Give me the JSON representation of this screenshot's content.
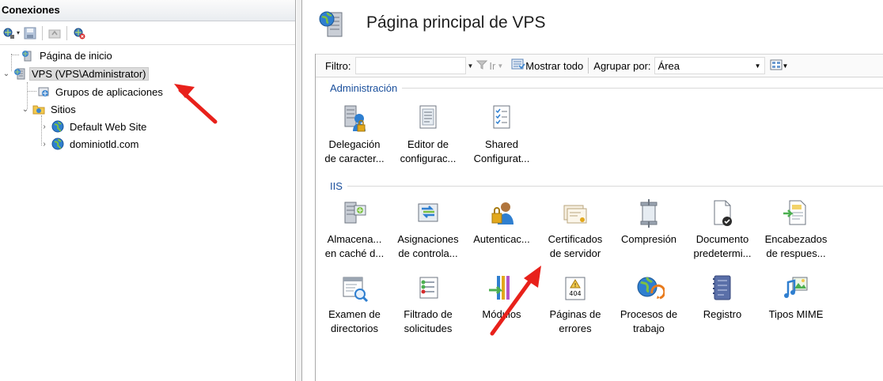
{
  "connections": {
    "header": "Conexiones",
    "toolbar_icons": [
      "connect-icon",
      "save-icon",
      "up-icon",
      "disconnect-icon"
    ],
    "tree": [
      {
        "label": "Página de inicio",
        "icon": "home-server-icon"
      },
      {
        "label": "VPS (VPS\\Administrator)",
        "icon": "server-icon",
        "selected": true
      },
      {
        "label": "Grupos de aplicaciones",
        "icon": "app-pool-icon"
      },
      {
        "label": "Sitios",
        "icon": "folder-icon"
      },
      {
        "label": "Default Web Site",
        "icon": "globe-icon"
      },
      {
        "label": "dominiotld.com",
        "icon": "globe-icon"
      }
    ]
  },
  "main": {
    "title": "Página principal de VPS",
    "filter": {
      "label": "Filtro:",
      "value": "",
      "go_label": "Ir",
      "show_all_label": "Mostrar todo",
      "group_by_label": "Agrupar por:",
      "group_by_value": "Área"
    },
    "groups": [
      {
        "name": "Administración",
        "features": [
          {
            "line1": "Delegación",
            "line2": "de caracter...",
            "icon": "delegation-icon"
          },
          {
            "line1": "Editor de",
            "line2": "configurac...",
            "icon": "config-editor-icon"
          },
          {
            "line1": "Shared",
            "line2": "Configurat...",
            "icon": "shared-config-icon"
          }
        ]
      },
      {
        "name": "IIS",
        "features": [
          {
            "line1": "Almacena...",
            "line2": "en caché d...",
            "icon": "output-cache-icon"
          },
          {
            "line1": "Asignaciones",
            "line2": "de controla...",
            "icon": "handler-mappings-icon"
          },
          {
            "line1": "Autenticac...",
            "line2": "",
            "icon": "authentication-icon"
          },
          {
            "line1": "Certificados",
            "line2": "de servidor",
            "icon": "server-certificates-icon"
          },
          {
            "line1": "Compresión",
            "line2": "",
            "icon": "compression-icon"
          },
          {
            "line1": "Documento",
            "line2": "predetermi...",
            "icon": "default-document-icon"
          },
          {
            "line1": "Encabezados",
            "line2": "de respues...",
            "icon": "response-headers-icon"
          },
          {
            "line1": "Examen de",
            "line2": "directorios",
            "icon": "directory-browsing-icon"
          },
          {
            "line1": "Filtrado de",
            "line2": "solicitudes",
            "icon": "request-filtering-icon"
          },
          {
            "line1": "Módulos",
            "line2": "",
            "icon": "modules-icon"
          },
          {
            "line1": "Páginas de",
            "line2": "errores",
            "icon": "error-pages-icon"
          },
          {
            "line1": "Procesos de",
            "line2": "trabajo",
            "icon": "worker-processes-icon"
          },
          {
            "line1": "Registro",
            "line2": "",
            "icon": "logging-icon"
          },
          {
            "line1": "Tipos MIME",
            "line2": "",
            "icon": "mime-types-icon"
          }
        ]
      }
    ]
  },
  "colors": {
    "group_header": "#1a4f9c",
    "arrow": "#e8211b",
    "selection": "#dcdcdc"
  }
}
